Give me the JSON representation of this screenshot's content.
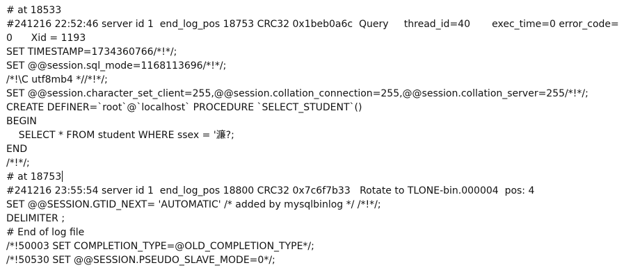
{
  "lines": [
    "# at 18533",
    "#241216 22:52:46 server id 1  end_log_pos 18753 CRC32 0x1beb0a6c  Query     thread_id=40       exec_time=0 error_code=",
    "0      Xid = 1193",
    "SET TIMESTAMP=1734360766/*!*/;",
    "SET @@session.sql_mode=1168113696/*!*/;",
    "/*!\\C utf8mb4 *//*!*/;",
    "SET @@session.character_set_client=255,@@session.collation_connection=255,@@session.collation_server=255/*!*/;",
    "CREATE DEFINER=`root`@`localhost` PROCEDURE `SELECT_STUDENT`()",
    "BEGIN",
    "    SELECT * FROM student WHERE ssex = '濂?;",
    "END",
    "/*!*/;",
    "# at 18753",
    "#241216 23:55:54 server id 1  end_log_pos 18800 CRC32 0x7c6f7b33   Rotate to TLONE-bin.000004  pos: 4",
    "SET @@SESSION.GTID_NEXT= 'AUTOMATIC' /* added by mysqlbinlog */ /*!*/;",
    "DELIMITER ;",
    "# End of log file",
    "/*!50003 SET COMPLETION_TYPE=@OLD_COMPLETION_TYPE*/;",
    "/*!50530 SET @@SESSION.PSEUDO_SLAVE_MODE=0*/;"
  ]
}
